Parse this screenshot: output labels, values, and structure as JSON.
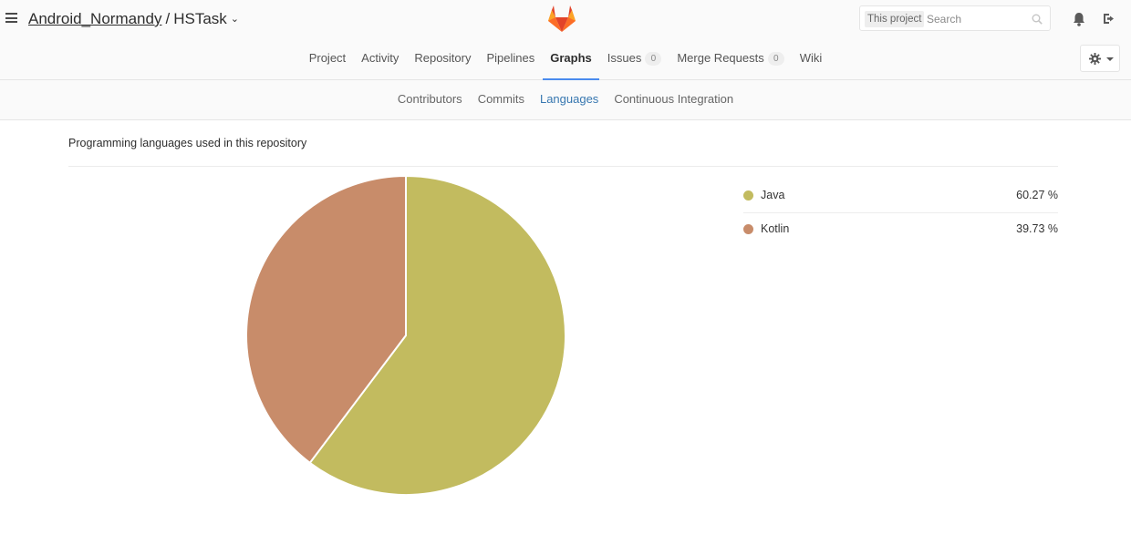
{
  "header": {
    "group": "Android_Normandy",
    "separator": "/",
    "project": "HSTask",
    "search": {
      "scope": "This project",
      "placeholder": "Search"
    }
  },
  "nav": {
    "items": [
      {
        "label": "Project"
      },
      {
        "label": "Activity"
      },
      {
        "label": "Repository"
      },
      {
        "label": "Pipelines"
      },
      {
        "label": "Graphs",
        "active": true
      },
      {
        "label": "Issues",
        "count": "0"
      },
      {
        "label": "Merge Requests",
        "count": "0"
      },
      {
        "label": "Wiki"
      }
    ]
  },
  "subnav": {
    "items": [
      {
        "label": "Contributors"
      },
      {
        "label": "Commits"
      },
      {
        "label": "Languages",
        "active": true
      },
      {
        "label": "Continuous Integration"
      }
    ]
  },
  "content": {
    "title": "Programming languages used in this repository"
  },
  "colors": {
    "accent": "#4a8bee",
    "link": "#3777b0",
    "java": "#c2bb5f",
    "kotlin": "#c88c6a"
  },
  "chart_data": {
    "type": "pie",
    "categories": [
      "Java",
      "Kotlin"
    ],
    "values": [
      60.27,
      39.73
    ],
    "colors": [
      "#c2bb5f",
      "#c88c6a"
    ],
    "legend_placement": "right",
    "legend_values": [
      "60.27 %",
      "39.73 %"
    ]
  }
}
